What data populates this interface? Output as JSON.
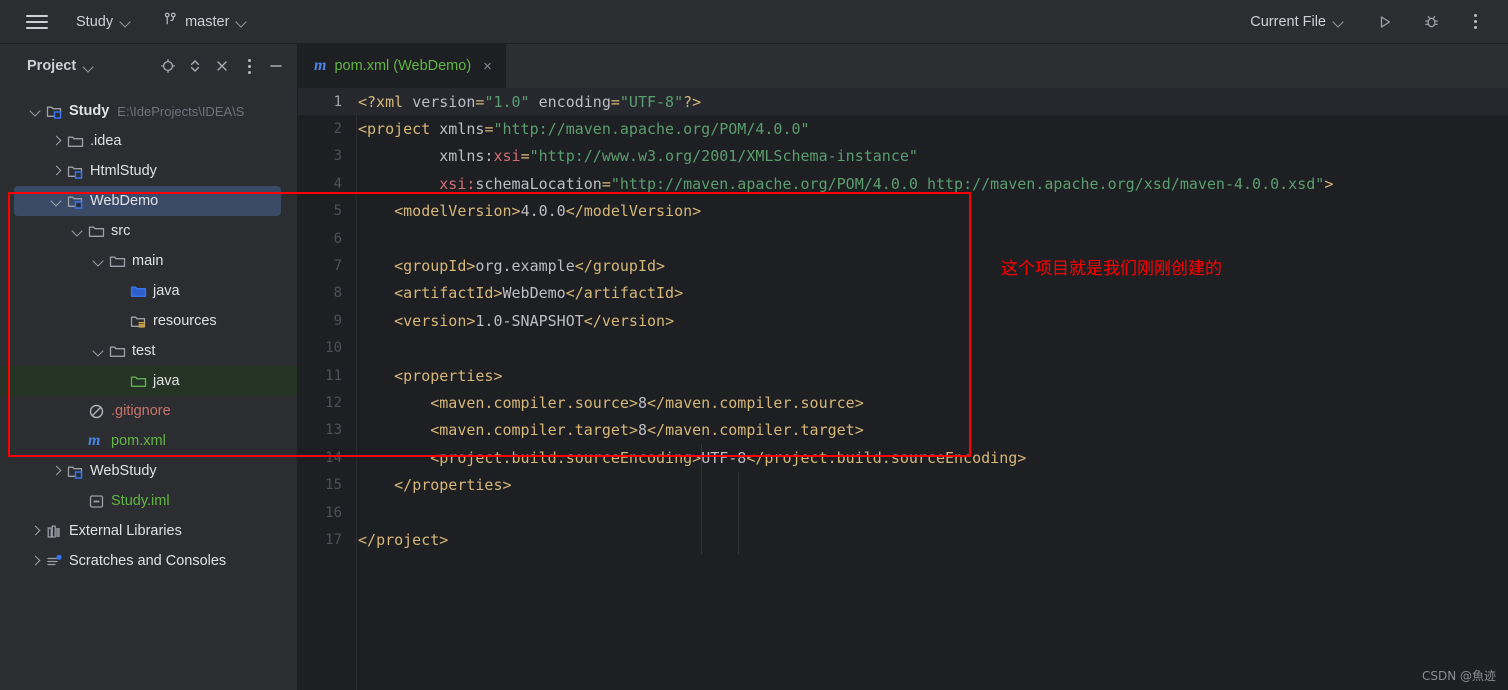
{
  "toolbar": {
    "menu_icon": "hamburger-icon",
    "project_name": "Study",
    "branch_icon": "git-branch-icon",
    "branch_name": "master",
    "run_config": "Current File",
    "run_icon": "run-icon",
    "debug_icon": "debug-icon",
    "more_icon": "kebab-menu-icon"
  },
  "project_panel": {
    "title": "Project",
    "tools": [
      {
        "name": "locate-icon",
        "label": "Select Opened File"
      },
      {
        "name": "expand-collapse-icon",
        "label": "Expand/Collapse"
      },
      {
        "name": "collapse-all-icon",
        "label": "Collapse All"
      },
      {
        "name": "options-icon",
        "label": "Options"
      },
      {
        "name": "hide-icon",
        "label": "Hide"
      }
    ],
    "tree": [
      {
        "label": "Study",
        "path": "E:\\IdeProjects\\IDEA\\S",
        "icon": "module-folder-icon",
        "arrow": "open",
        "indent": 0,
        "bold": true,
        "color": "default",
        "state": "normal"
      },
      {
        "label": ".idea",
        "path": "",
        "icon": "folder-icon",
        "arrow": "closed",
        "indent": 1,
        "bold": false,
        "color": "default",
        "state": "normal"
      },
      {
        "label": "HtmlStudy",
        "path": "",
        "icon": "module-folder-icon",
        "arrow": "closed",
        "indent": 1,
        "bold": false,
        "color": "default",
        "state": "normal"
      },
      {
        "label": "WebDemo",
        "path": "",
        "icon": "module-folder-icon",
        "arrow": "open",
        "indent": 1,
        "bold": false,
        "color": "default",
        "state": "selected"
      },
      {
        "label": "src",
        "path": "",
        "icon": "folder-icon",
        "arrow": "open",
        "indent": 2,
        "bold": false,
        "color": "default",
        "state": "normal"
      },
      {
        "label": "main",
        "path": "",
        "icon": "folder-icon",
        "arrow": "open",
        "indent": 3,
        "bold": false,
        "color": "default",
        "state": "normal"
      },
      {
        "label": "java",
        "path": "",
        "icon": "sources-root-icon",
        "arrow": "none",
        "indent": 4,
        "bold": false,
        "color": "default",
        "state": "normal"
      },
      {
        "label": "resources",
        "path": "",
        "icon": "resources-root-icon",
        "arrow": "none",
        "indent": 4,
        "bold": false,
        "color": "default",
        "state": "normal"
      },
      {
        "label": "test",
        "path": "",
        "icon": "folder-icon",
        "arrow": "open",
        "indent": 3,
        "bold": false,
        "color": "default",
        "state": "normal"
      },
      {
        "label": "java",
        "path": "",
        "icon": "test-sources-root-icon",
        "arrow": "none",
        "indent": 4,
        "bold": false,
        "color": "default",
        "state": "green-highlight"
      },
      {
        "label": ".gitignore",
        "path": "",
        "icon": "gitignore-icon",
        "arrow": "none",
        "indent": 2,
        "bold": false,
        "color": "red",
        "state": "normal"
      },
      {
        "label": "pom.xml",
        "path": "",
        "icon": "maven-icon",
        "arrow": "none",
        "indent": 2,
        "bold": false,
        "color": "green",
        "state": "normal"
      },
      {
        "label": "WebStudy",
        "path": "",
        "icon": "module-folder-icon",
        "arrow": "closed",
        "indent": 1,
        "bold": false,
        "color": "default",
        "state": "normal"
      },
      {
        "label": "Study.iml",
        "path": "",
        "icon": "iml-file-icon",
        "arrow": "none",
        "indent": 2,
        "bold": false,
        "color": "green",
        "state": "normal"
      },
      {
        "label": "External Libraries",
        "path": "",
        "icon": "library-icon",
        "arrow": "closed",
        "indent": 0,
        "bold": false,
        "color": "default",
        "state": "normal"
      },
      {
        "label": "Scratches and Consoles",
        "path": "",
        "icon": "scratches-icon",
        "arrow": "closed",
        "indent": 0,
        "bold": false,
        "color": "default",
        "state": "normal"
      }
    ]
  },
  "editor": {
    "tab": {
      "icon": "maven-icon",
      "label": "pom.xml (WebDemo)",
      "close": "×"
    },
    "lines": [
      {
        "n": "1",
        "current": true,
        "segments": [
          {
            "t": "punc",
            "s": "<?xml"
          },
          {
            "t": "txt",
            "s": " "
          },
          {
            "t": "attr",
            "s": "version"
          },
          {
            "t": "punc",
            "s": "="
          },
          {
            "t": "val",
            "s": "\"1.0\""
          },
          {
            "t": "txt",
            "s": " "
          },
          {
            "t": "attr",
            "s": "encoding"
          },
          {
            "t": "punc",
            "s": "="
          },
          {
            "t": "val",
            "s": "\"UTF-8\""
          },
          {
            "t": "punc",
            "s": "?>"
          }
        ]
      },
      {
        "n": "2",
        "current": false,
        "segments": [
          {
            "t": "punc",
            "s": "<"
          },
          {
            "t": "tag",
            "s": "project"
          },
          {
            "t": "txt",
            "s": " "
          },
          {
            "t": "attr",
            "s": "xmlns"
          },
          {
            "t": "punc",
            "s": "="
          },
          {
            "t": "val",
            "s": "\"http://maven.apache.org/POM/4.0.0\""
          }
        ]
      },
      {
        "n": "3",
        "current": false,
        "segments": [
          {
            "t": "txt",
            "s": "         "
          },
          {
            "t": "attr",
            "s": "xmlns:"
          },
          {
            "t": "ns",
            "s": "xsi"
          },
          {
            "t": "punc",
            "s": "="
          },
          {
            "t": "val",
            "s": "\"http://www.w3.org/2001/XMLSchema-instance\""
          }
        ]
      },
      {
        "n": "4",
        "current": false,
        "segments": [
          {
            "t": "txt",
            "s": "         "
          },
          {
            "t": "ns",
            "s": "xsi:"
          },
          {
            "t": "attr",
            "s": "schemaLocation"
          },
          {
            "t": "punc",
            "s": "="
          },
          {
            "t": "val",
            "s": "\"http://maven.apache.org/POM/4.0.0 http://maven.apache.org/xsd/maven-4.0.0.xsd\""
          },
          {
            "t": "punc",
            "s": ">"
          }
        ]
      },
      {
        "n": "5",
        "current": false,
        "segments": [
          {
            "t": "txt",
            "s": "    "
          },
          {
            "t": "punc",
            "s": "<"
          },
          {
            "t": "tag",
            "s": "modelVersion"
          },
          {
            "t": "punc",
            "s": ">"
          },
          {
            "t": "txt",
            "s": "4.0.0"
          },
          {
            "t": "punc",
            "s": "</"
          },
          {
            "t": "tag",
            "s": "modelVersion"
          },
          {
            "t": "punc",
            "s": ">"
          }
        ]
      },
      {
        "n": "6",
        "current": false,
        "segments": []
      },
      {
        "n": "7",
        "current": false,
        "segments": [
          {
            "t": "txt",
            "s": "    "
          },
          {
            "t": "punc",
            "s": "<"
          },
          {
            "t": "tag",
            "s": "groupId"
          },
          {
            "t": "punc",
            "s": ">"
          },
          {
            "t": "txt",
            "s": "org.example"
          },
          {
            "t": "punc",
            "s": "</"
          },
          {
            "t": "tag",
            "s": "groupId"
          },
          {
            "t": "punc",
            "s": ">"
          }
        ]
      },
      {
        "n": "8",
        "current": false,
        "segments": [
          {
            "t": "txt",
            "s": "    "
          },
          {
            "t": "punc",
            "s": "<"
          },
          {
            "t": "tag",
            "s": "artifactId"
          },
          {
            "t": "punc",
            "s": ">"
          },
          {
            "t": "txt",
            "s": "WebDemo"
          },
          {
            "t": "punc",
            "s": "</"
          },
          {
            "t": "tag",
            "s": "artifactId"
          },
          {
            "t": "punc",
            "s": ">"
          }
        ]
      },
      {
        "n": "9",
        "current": false,
        "segments": [
          {
            "t": "txt",
            "s": "    "
          },
          {
            "t": "punc",
            "s": "<"
          },
          {
            "t": "tag",
            "s": "version"
          },
          {
            "t": "punc",
            "s": ">"
          },
          {
            "t": "txt",
            "s": "1.0-SNAPSHOT"
          },
          {
            "t": "punc",
            "s": "</"
          },
          {
            "t": "tag",
            "s": "version"
          },
          {
            "t": "punc",
            "s": ">"
          }
        ]
      },
      {
        "n": "10",
        "current": false,
        "segments": []
      },
      {
        "n": "11",
        "current": false,
        "segments": [
          {
            "t": "txt",
            "s": "    "
          },
          {
            "t": "punc",
            "s": "<"
          },
          {
            "t": "tag",
            "s": "properties"
          },
          {
            "t": "punc",
            "s": ">"
          }
        ]
      },
      {
        "n": "12",
        "current": false,
        "segments": [
          {
            "t": "txt",
            "s": "        "
          },
          {
            "t": "punc",
            "s": "<"
          },
          {
            "t": "tag",
            "s": "maven.compiler.source"
          },
          {
            "t": "punc",
            "s": ">"
          },
          {
            "t": "txt",
            "s": "8"
          },
          {
            "t": "punc",
            "s": "</"
          },
          {
            "t": "tag",
            "s": "maven.compiler.source"
          },
          {
            "t": "punc",
            "s": ">"
          }
        ]
      },
      {
        "n": "13",
        "current": false,
        "segments": [
          {
            "t": "txt",
            "s": "        "
          },
          {
            "t": "punc",
            "s": "<"
          },
          {
            "t": "tag",
            "s": "maven.compiler.target"
          },
          {
            "t": "punc",
            "s": ">"
          },
          {
            "t": "txt",
            "s": "8"
          },
          {
            "t": "punc",
            "s": "</"
          },
          {
            "t": "tag",
            "s": "maven.compiler.target"
          },
          {
            "t": "punc",
            "s": ">"
          }
        ]
      },
      {
        "n": "14",
        "current": false,
        "segments": [
          {
            "t": "txt",
            "s": "        "
          },
          {
            "t": "punc",
            "s": "<"
          },
          {
            "t": "tag",
            "s": "project.build.sourceEncoding"
          },
          {
            "t": "punc",
            "s": ">"
          },
          {
            "t": "txt",
            "s": "UTF-8"
          },
          {
            "t": "punc",
            "s": "</"
          },
          {
            "t": "tag",
            "s": "project.build.sourceEncoding"
          },
          {
            "t": "punc",
            "s": ">"
          }
        ]
      },
      {
        "n": "15",
        "current": false,
        "segments": [
          {
            "t": "txt",
            "s": "    "
          },
          {
            "t": "punc",
            "s": "</"
          },
          {
            "t": "tag",
            "s": "properties"
          },
          {
            "t": "punc",
            "s": ">"
          }
        ]
      },
      {
        "n": "16",
        "current": false,
        "segments": []
      },
      {
        "n": "17",
        "current": false,
        "segments": [
          {
            "t": "punc",
            "s": "</"
          },
          {
            "t": "tag",
            "s": "project"
          },
          {
            "t": "punc",
            "s": ">"
          }
        ]
      }
    ]
  },
  "annotations": {
    "note_text": "这个项目就是我们刚刚创建的",
    "note_color": "#FF0000",
    "rect_color": "#FF0000"
  },
  "watermark": "CSDN @魚迹"
}
